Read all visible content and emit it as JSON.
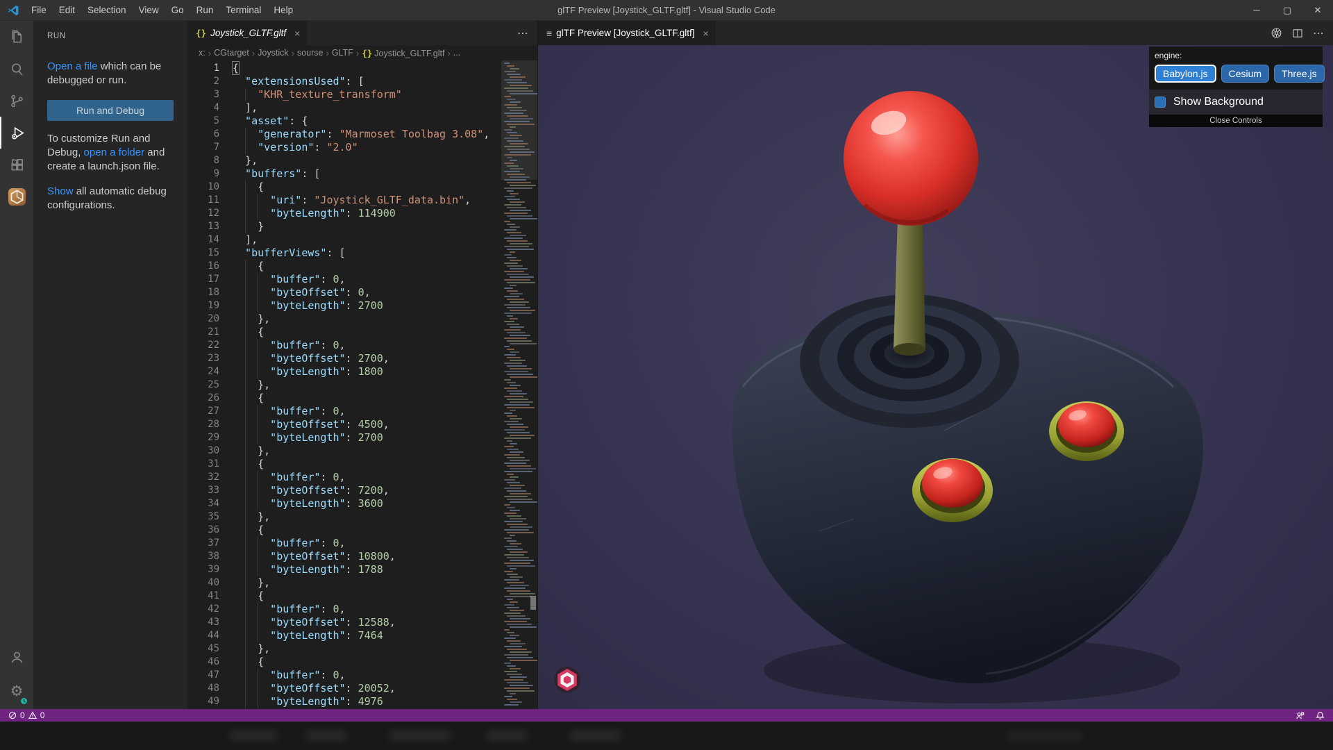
{
  "window": {
    "title": "glTF Preview [Joystick_GLTF.gltf] - Visual Studio Code",
    "menu": [
      "File",
      "Edit",
      "Selection",
      "View",
      "Go",
      "Run",
      "Terminal",
      "Help"
    ],
    "controls": {
      "minimize": "─",
      "maximize": "▢",
      "close": "✕"
    }
  },
  "activity_bar": {
    "top_icons": [
      "explorer-icon",
      "search-icon",
      "source-control-icon",
      "run-debug-icon",
      "extensions-icon",
      "gltf-extension-icon"
    ],
    "bottom_icons": [
      "accounts-icon",
      "settings-icon"
    ],
    "active": "run-debug-icon"
  },
  "sidebar": {
    "title": "RUN",
    "paragraph_open": [
      {
        "t": "Open a file",
        "link": true
      },
      {
        "t": " which can be debugged or run.",
        "link": false
      }
    ],
    "run_button": "Run and Debug",
    "paragraph_customize": [
      {
        "t": "To customize Run and Debug, ",
        "link": false
      },
      {
        "t": "open a folder",
        "link": true
      },
      {
        "t": " and create a launch.json file.",
        "link": false
      }
    ],
    "paragraph_show": [
      {
        "t": "Show",
        "link": true
      },
      {
        "t": " all automatic debug configurations.",
        "link": false
      }
    ]
  },
  "editor": {
    "tab": {
      "icon": "{}",
      "label": "Joystick_GLTF.gltf",
      "close": "×"
    },
    "actions_more": "⋯",
    "breadcrumb": [
      {
        "label": "x:"
      },
      {
        "label": "CGtarget"
      },
      {
        "label": "Joystick"
      },
      {
        "label": "sourse"
      },
      {
        "label": "GLTF"
      },
      {
        "label": "Joystick_GLTF.gltf",
        "icon": "{}"
      },
      {
        "label": "..."
      }
    ],
    "code_lines": [
      [
        0,
        [
          [
            "{",
            "p"
          ]
        ]
      ],
      [
        2,
        [
          [
            "\"extensionsUsed\"",
            "k"
          ],
          [
            ": [",
            "p"
          ]
        ]
      ],
      [
        4,
        [
          [
            "\"KHR_texture_transform\"",
            "s"
          ]
        ]
      ],
      [
        2,
        [
          [
            "],",
            "p"
          ]
        ]
      ],
      [
        2,
        [
          [
            "\"asset\"",
            "k"
          ],
          [
            ": {",
            "p"
          ]
        ]
      ],
      [
        4,
        [
          [
            "\"generator\"",
            "k"
          ],
          [
            ": ",
            "p"
          ],
          [
            "\"Marmoset Toolbag 3.08\"",
            "s"
          ],
          [
            ",",
            "p"
          ]
        ]
      ],
      [
        4,
        [
          [
            "\"version\"",
            "k"
          ],
          [
            ": ",
            "p"
          ],
          [
            "\"2.0\"",
            "s"
          ]
        ]
      ],
      [
        2,
        [
          [
            "},",
            "p"
          ]
        ]
      ],
      [
        2,
        [
          [
            "\"buffers\"",
            "k"
          ],
          [
            ": [",
            "p"
          ]
        ]
      ],
      [
        4,
        [
          [
            "{",
            "p"
          ]
        ]
      ],
      [
        6,
        [
          [
            "\"uri\"",
            "k"
          ],
          [
            ": ",
            "p"
          ],
          [
            "\"Joystick_GLTF_data.bin\"",
            "s"
          ],
          [
            ",",
            "p"
          ]
        ]
      ],
      [
        6,
        [
          [
            "\"byteLength\"",
            "k"
          ],
          [
            ": ",
            "p"
          ],
          [
            "114900",
            "n"
          ]
        ]
      ],
      [
        4,
        [
          [
            "}",
            "p"
          ]
        ]
      ],
      [
        2,
        [
          [
            "],",
            "p"
          ]
        ]
      ],
      [
        2,
        [
          [
            "\"bufferViews\"",
            "k"
          ],
          [
            ": [",
            "p"
          ]
        ]
      ],
      [
        4,
        [
          [
            "{",
            "p"
          ]
        ]
      ],
      [
        6,
        [
          [
            "\"buffer\"",
            "k"
          ],
          [
            ": ",
            "p"
          ],
          [
            "0",
            "n"
          ],
          [
            ",",
            "p"
          ]
        ]
      ],
      [
        6,
        [
          [
            "\"byteOffset\"",
            "k"
          ],
          [
            ": ",
            "p"
          ],
          [
            "0",
            "n"
          ],
          [
            ",",
            "p"
          ]
        ]
      ],
      [
        6,
        [
          [
            "\"byteLength\"",
            "k"
          ],
          [
            ": ",
            "p"
          ],
          [
            "2700",
            "n"
          ]
        ]
      ],
      [
        4,
        [
          [
            "},",
            "p"
          ]
        ]
      ],
      [
        4,
        [
          [
            "{",
            "p"
          ]
        ]
      ],
      [
        6,
        [
          [
            "\"buffer\"",
            "k"
          ],
          [
            ": ",
            "p"
          ],
          [
            "0",
            "n"
          ],
          [
            ",",
            "p"
          ]
        ]
      ],
      [
        6,
        [
          [
            "\"byteOffset\"",
            "k"
          ],
          [
            ": ",
            "p"
          ],
          [
            "2700",
            "n"
          ],
          [
            ",",
            "p"
          ]
        ]
      ],
      [
        6,
        [
          [
            "\"byteLength\"",
            "k"
          ],
          [
            ": ",
            "p"
          ],
          [
            "1800",
            "n"
          ]
        ]
      ],
      [
        4,
        [
          [
            "},",
            "p"
          ]
        ]
      ],
      [
        4,
        [
          [
            "{",
            "p"
          ]
        ]
      ],
      [
        6,
        [
          [
            "\"buffer\"",
            "k"
          ],
          [
            ": ",
            "p"
          ],
          [
            "0",
            "n"
          ],
          [
            ",",
            "p"
          ]
        ]
      ],
      [
        6,
        [
          [
            "\"byteOffset\"",
            "k"
          ],
          [
            ": ",
            "p"
          ],
          [
            "4500",
            "n"
          ],
          [
            ",",
            "p"
          ]
        ]
      ],
      [
        6,
        [
          [
            "\"byteLength\"",
            "k"
          ],
          [
            ": ",
            "p"
          ],
          [
            "2700",
            "n"
          ]
        ]
      ],
      [
        4,
        [
          [
            "},",
            "p"
          ]
        ]
      ],
      [
        4,
        [
          [
            "{",
            "p"
          ]
        ]
      ],
      [
        6,
        [
          [
            "\"buffer\"",
            "k"
          ],
          [
            ": ",
            "p"
          ],
          [
            "0",
            "n"
          ],
          [
            ",",
            "p"
          ]
        ]
      ],
      [
        6,
        [
          [
            "\"byteOffset\"",
            "k"
          ],
          [
            ": ",
            "p"
          ],
          [
            "7200",
            "n"
          ],
          [
            ",",
            "p"
          ]
        ]
      ],
      [
        6,
        [
          [
            "\"byteLength\"",
            "k"
          ],
          [
            ": ",
            "p"
          ],
          [
            "3600",
            "n"
          ]
        ]
      ],
      [
        4,
        [
          [
            "},",
            "p"
          ]
        ]
      ],
      [
        4,
        [
          [
            "{",
            "p"
          ]
        ]
      ],
      [
        6,
        [
          [
            "\"buffer\"",
            "k"
          ],
          [
            ": ",
            "p"
          ],
          [
            "0",
            "n"
          ],
          [
            ",",
            "p"
          ]
        ]
      ],
      [
        6,
        [
          [
            "\"byteOffset\"",
            "k"
          ],
          [
            ": ",
            "p"
          ],
          [
            "10800",
            "n"
          ],
          [
            ",",
            "p"
          ]
        ]
      ],
      [
        6,
        [
          [
            "\"byteLength\"",
            "k"
          ],
          [
            ": ",
            "p"
          ],
          [
            "1788",
            "n"
          ]
        ]
      ],
      [
        4,
        [
          [
            "},",
            "p"
          ]
        ]
      ],
      [
        4,
        [
          [
            "{",
            "p"
          ]
        ]
      ],
      [
        6,
        [
          [
            "\"buffer\"",
            "k"
          ],
          [
            ": ",
            "p"
          ],
          [
            "0",
            "n"
          ],
          [
            ",",
            "p"
          ]
        ]
      ],
      [
        6,
        [
          [
            "\"byteOffset\"",
            "k"
          ],
          [
            ": ",
            "p"
          ],
          [
            "12588",
            "n"
          ],
          [
            ",",
            "p"
          ]
        ]
      ],
      [
        6,
        [
          [
            "\"byteLength\"",
            "k"
          ],
          [
            ": ",
            "p"
          ],
          [
            "7464",
            "n"
          ]
        ]
      ],
      [
        4,
        [
          [
            "},",
            "p"
          ]
        ]
      ],
      [
        4,
        [
          [
            "{",
            "p"
          ]
        ]
      ],
      [
        6,
        [
          [
            "\"buffer\"",
            "k"
          ],
          [
            ": ",
            "p"
          ],
          [
            "0",
            "n"
          ],
          [
            ",",
            "p"
          ]
        ]
      ],
      [
        6,
        [
          [
            "\"byteOffset\"",
            "k"
          ],
          [
            ": ",
            "p"
          ],
          [
            "20052",
            "n"
          ],
          [
            ",",
            "p"
          ]
        ]
      ],
      [
        6,
        [
          [
            "\"byteLength\"",
            "k"
          ],
          [
            ": ",
            "p"
          ],
          [
            "4976",
            "n"
          ]
        ]
      ]
    ]
  },
  "preview": {
    "tab": {
      "icon": "≡",
      "label": "glTF Preview [Joystick_GLTF.gltf]",
      "close": "×"
    },
    "actions": [
      "gltf-wheel-icon",
      "split-editor-icon",
      "more-actions-icon"
    ],
    "engine_panel": {
      "label": "engine:",
      "engines": [
        {
          "label": "Babylon.js",
          "active": true
        },
        {
          "label": "Cesium",
          "active": false
        },
        {
          "label": "Three.js",
          "active": false
        }
      ],
      "show_background": "Show Background",
      "close_controls": "Close Controls"
    },
    "colors": {
      "background": "#353350",
      "ball_red": "#e8423c",
      "base_dark": "#2a3040",
      "ring_olive": "#aab23f"
    }
  },
  "status_bar": {
    "errors": "0",
    "warnings": "0",
    "icons": [
      "error-circle-icon",
      "warning-triangle-icon",
      "feedback-icon",
      "bell-icon"
    ],
    "color": "#6e2480"
  }
}
